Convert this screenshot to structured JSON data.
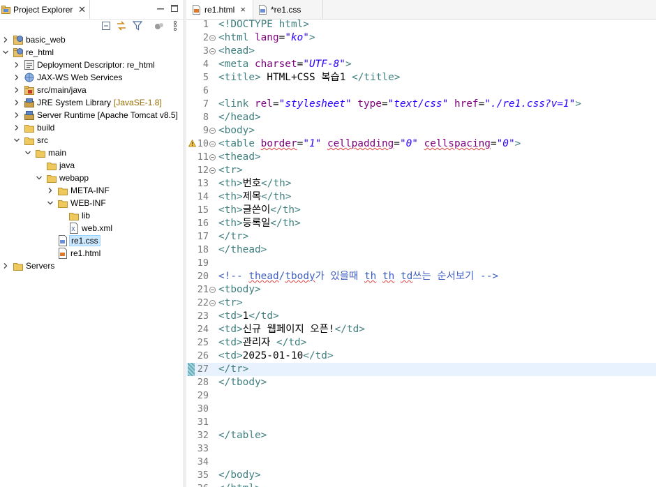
{
  "explorer": {
    "tab_label": "Project Explorer",
    "tree": [
      {
        "label": "basic_web",
        "icon": "web-project-icon",
        "expanded": false,
        "level": 0
      },
      {
        "label": "re_html",
        "icon": "web-project-icon",
        "expanded": true,
        "level": 0
      },
      {
        "label": "Deployment Descriptor: re_html",
        "icon": "deployment-descriptor-icon",
        "expanded": false,
        "level": 1
      },
      {
        "label": "JAX-WS Web Services",
        "icon": "web-services-icon",
        "expanded": false,
        "level": 1
      },
      {
        "label": "src/main/java",
        "icon": "source-folder-icon",
        "expanded": false,
        "level": 1
      },
      {
        "label": "JRE System Library",
        "decoration": "[JavaSE-1.8]",
        "icon": "library-icon",
        "expanded": false,
        "level": 1
      },
      {
        "label": "Server Runtime [Apache Tomcat v8.5]",
        "icon": "library-icon",
        "expanded": false,
        "level": 1
      },
      {
        "label": "build",
        "icon": "folder-icon",
        "expanded": false,
        "level": 1
      },
      {
        "label": "src",
        "icon": "folder-icon",
        "expanded": true,
        "level": 1
      },
      {
        "label": "main",
        "icon": "folder-icon",
        "expanded": true,
        "level": 2
      },
      {
        "label": "java",
        "icon": "folder-icon",
        "leaf": true,
        "level": 3
      },
      {
        "label": "webapp",
        "icon": "folder-icon",
        "expanded": true,
        "level": 3
      },
      {
        "label": "META-INF",
        "icon": "folder-icon",
        "expanded": false,
        "level": 4
      },
      {
        "label": "WEB-INF",
        "icon": "folder-icon",
        "expanded": true,
        "level": 4
      },
      {
        "label": "lib",
        "icon": "folder-icon",
        "leaf": true,
        "level": 5
      },
      {
        "label": "web.xml",
        "icon": "xml-file-icon",
        "leaf": true,
        "level": 5
      },
      {
        "label": "re1.css",
        "icon": "css-file-icon",
        "leaf": true,
        "level": 4,
        "selected": true
      },
      {
        "label": "re1.html",
        "icon": "html-file-icon",
        "leaf": true,
        "level": 4
      },
      {
        "label": "Servers",
        "icon": "folder-icon",
        "expanded": false,
        "level": 0
      }
    ]
  },
  "editor": {
    "tabs": [
      {
        "label": "re1.html",
        "active": true,
        "close": "×"
      },
      {
        "label": "*re1.css",
        "active": false
      }
    ],
    "current_line": 27,
    "lines": [
      {
        "n": "1",
        "tokens": [
          [
            "t",
            "<!DOCTYPE html>"
          ]
        ]
      },
      {
        "n": "2",
        "fold": true,
        "tokens": [
          [
            "t",
            "<html "
          ],
          [
            "a",
            "lang"
          ],
          [
            "",
            "="
          ],
          [
            "v",
            "\"ko\""
          ],
          [
            "t",
            ">"
          ]
        ]
      },
      {
        "n": "3",
        "fold": true,
        "tokens": [
          [
            "t",
            "<head>"
          ]
        ]
      },
      {
        "n": "4",
        "tokens": [
          [
            "t",
            "<meta "
          ],
          [
            "a",
            "charset"
          ],
          [
            "",
            "="
          ],
          [
            "v",
            "\"UTF-8\""
          ],
          [
            "t",
            ">"
          ]
        ]
      },
      {
        "n": "5",
        "tokens": [
          [
            "t",
            "<title>"
          ],
          [
            "",
            " HTML+CSS 복습1 "
          ],
          [
            "t",
            "</title>"
          ]
        ]
      },
      {
        "n": "6",
        "tokens": []
      },
      {
        "n": "7",
        "tokens": [
          [
            "t",
            "<link "
          ],
          [
            "a",
            "rel"
          ],
          [
            "",
            "="
          ],
          [
            "v",
            "\"stylesheet\""
          ],
          [
            "",
            " "
          ],
          [
            "a",
            "type"
          ],
          [
            "",
            "="
          ],
          [
            "v",
            "\"text/css\""
          ],
          [
            "",
            " "
          ],
          [
            "a",
            "href"
          ],
          [
            "",
            "="
          ],
          [
            "v",
            "\"./re1.css?v=1\""
          ],
          [
            "t",
            ">"
          ]
        ]
      },
      {
        "n": "8",
        "tokens": [
          [
            "t",
            "</head>"
          ]
        ]
      },
      {
        "n": "9",
        "fold": true,
        "tokens": [
          [
            "t",
            "<body>"
          ]
        ]
      },
      {
        "n": "10",
        "fold": true,
        "warning": true,
        "tokens": [
          [
            "t",
            "<table "
          ],
          [
            "a squig",
            "border"
          ],
          [
            "",
            "="
          ],
          [
            "v",
            "\"1\""
          ],
          [
            "",
            " "
          ],
          [
            "a squig",
            "cellpadding"
          ],
          [
            "",
            "="
          ],
          [
            "v",
            "\"0\""
          ],
          [
            "",
            " "
          ],
          [
            "a squig",
            "cellspacing"
          ],
          [
            "",
            "="
          ],
          [
            "v",
            "\"0\""
          ],
          [
            "t",
            ">"
          ]
        ]
      },
      {
        "n": "11",
        "fold": true,
        "tokens": [
          [
            "t",
            "<thead>"
          ]
        ]
      },
      {
        "n": "12",
        "fold": true,
        "tokens": [
          [
            "t",
            "<tr>"
          ]
        ]
      },
      {
        "n": "13",
        "tokens": [
          [
            "t",
            "<th>"
          ],
          [
            "",
            "번호"
          ],
          [
            "t",
            "</th>"
          ]
        ]
      },
      {
        "n": "14",
        "tokens": [
          [
            "t",
            "<th>"
          ],
          [
            "",
            "제목"
          ],
          [
            "t",
            "</th>"
          ]
        ]
      },
      {
        "n": "15",
        "tokens": [
          [
            "t",
            "<th>"
          ],
          [
            "",
            "글쓴이"
          ],
          [
            "t",
            "</th>"
          ]
        ]
      },
      {
        "n": "16",
        "tokens": [
          [
            "t",
            "<th>"
          ],
          [
            "",
            "등록일"
          ],
          [
            "t",
            "</th>"
          ]
        ]
      },
      {
        "n": "17",
        "tokens": [
          [
            "t",
            "</tr>"
          ]
        ]
      },
      {
        "n": "18",
        "tokens": [
          [
            "t",
            "</thead>"
          ]
        ]
      },
      {
        "n": "19",
        "tokens": []
      },
      {
        "n": "20",
        "tokens": [
          [
            "c",
            "<!-- "
          ],
          [
            "c squig",
            "thead"
          ],
          [
            "c",
            "/"
          ],
          [
            "c squig",
            "tbody"
          ],
          [
            "c",
            "가 있을때 "
          ],
          [
            "c squig",
            "th"
          ],
          [
            "c",
            " "
          ],
          [
            "c squig",
            "th"
          ],
          [
            "c",
            " "
          ],
          [
            "c squig",
            "td"
          ],
          [
            "c",
            "쓰는 순서보기 -->"
          ]
        ]
      },
      {
        "n": "21",
        "fold": true,
        "tokens": [
          [
            "t",
            "<tbody>"
          ]
        ]
      },
      {
        "n": "22",
        "fold": true,
        "tokens": [
          [
            "t",
            "<tr>"
          ]
        ]
      },
      {
        "n": "23",
        "tokens": [
          [
            "t",
            "<td>"
          ],
          [
            "",
            "1"
          ],
          [
            "t",
            "</td>"
          ]
        ]
      },
      {
        "n": "24",
        "tokens": [
          [
            "t",
            "<td>"
          ],
          [
            "",
            "신규 웹페이지 오픈!"
          ],
          [
            "t",
            "</td>"
          ]
        ]
      },
      {
        "n": "25",
        "tokens": [
          [
            "t",
            "<td>"
          ],
          [
            "",
            "관리자 "
          ],
          [
            "t",
            "</td>"
          ]
        ]
      },
      {
        "n": "26",
        "tokens": [
          [
            "t",
            "<td>"
          ],
          [
            "",
            "2025-01-10"
          ],
          [
            "t",
            "</td>"
          ]
        ]
      },
      {
        "n": "27",
        "tokens": [
          [
            "t",
            "</tr>"
          ]
        ]
      },
      {
        "n": "28",
        "tokens": [
          [
            "t",
            "</tbody>"
          ]
        ]
      },
      {
        "n": "29",
        "tokens": []
      },
      {
        "n": "30",
        "tokens": []
      },
      {
        "n": "31",
        "tokens": []
      },
      {
        "n": "32",
        "tokens": [
          [
            "t",
            "</table>"
          ]
        ]
      },
      {
        "n": "33",
        "tokens": []
      },
      {
        "n": "34",
        "tokens": []
      },
      {
        "n": "35",
        "tokens": [
          [
            "t",
            "</body>"
          ]
        ]
      },
      {
        "n": "36",
        "tokens": [
          [
            "t",
            "</html>"
          ]
        ]
      }
    ]
  },
  "colors": {
    "tag": "#3f7f7f",
    "attribute": "#7f007f",
    "value": "#2a00ff",
    "comment": "#3f5fbf",
    "current_line": "#e8f2fe",
    "selection": "#cce8ff"
  }
}
